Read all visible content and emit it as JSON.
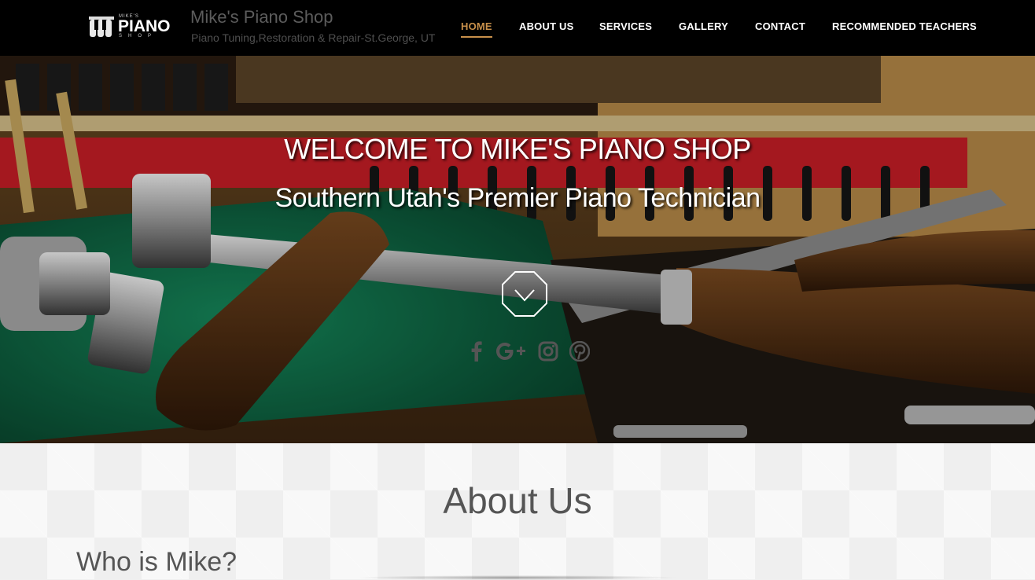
{
  "brand": {
    "logo_small": "MIKE'S",
    "logo_main": "PIANO",
    "logo_shop": "SHOP",
    "title": "Mike's Piano Shop",
    "tagline": "Piano Tuning,Restoration & Repair-St.George, UT"
  },
  "nav": {
    "items": [
      {
        "label": "HOME",
        "active": true
      },
      {
        "label": "ABOUT US",
        "active": false
      },
      {
        "label": "SERVICES",
        "active": false
      },
      {
        "label": "GALLERY",
        "active": false
      },
      {
        "label": "CONTACT",
        "active": false
      },
      {
        "label": "RECOMMENDED TEACHERS",
        "active": false
      }
    ]
  },
  "hero": {
    "title": "WELCOME TO MIKE'S PIANO SHOP",
    "subtitle": "Southern Utah's Premier Piano Technician",
    "scroll_icon": "chevron-down-octagon-icon",
    "social": [
      {
        "name": "facebook-icon",
        "glyph": "f"
      },
      {
        "name": "google-plus-icon",
        "glyph": "G+"
      },
      {
        "name": "instagram-icon",
        "glyph": ""
      },
      {
        "name": "pinterest-icon",
        "glyph": "p"
      }
    ]
  },
  "about": {
    "title": "About Us",
    "subtitle": "Who is Mike?"
  },
  "colors": {
    "header_bg": "#000000",
    "accent": "#c8904a",
    "about_bg": "#efefef",
    "heading_text": "#555555"
  }
}
